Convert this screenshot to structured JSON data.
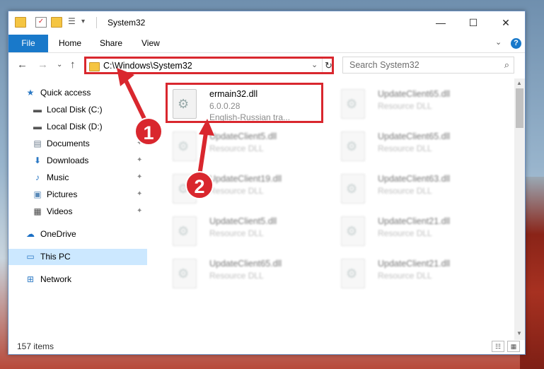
{
  "window": {
    "title": "System32",
    "controls": {
      "minimize": "—",
      "maximize": "☐",
      "close": "✕"
    }
  },
  "quick_access_toolbar": {
    "dropdown": "▾"
  },
  "ribbon": {
    "tabs": [
      {
        "label": "File",
        "active": true
      },
      {
        "label": "Home"
      },
      {
        "label": "Share"
      },
      {
        "label": "View"
      }
    ],
    "help": "?",
    "expand": "⌄"
  },
  "navigation": {
    "back": "←",
    "forward": "→",
    "recent": "⌄",
    "up": "↑",
    "address": "C:\\Windows\\System32",
    "address_dropdown": "⌄",
    "refresh": "↻",
    "search_placeholder": "Search System32",
    "search_icon": "⌕"
  },
  "sidebar": {
    "items": [
      {
        "label": "Quick access",
        "icon": "star-icon",
        "glyph": "★",
        "color": "#2a78c4"
      },
      {
        "label": "Local Disk (C:)",
        "icon": "drive-icon",
        "glyph": "▬",
        "color": "#555555",
        "pinned": true
      },
      {
        "label": "Local Disk (D:)",
        "icon": "drive-icon",
        "glyph": "▬",
        "color": "#555555",
        "pinned": true
      },
      {
        "label": "Documents",
        "icon": "documents-icon",
        "glyph": "▤",
        "color": "#6b7b8c",
        "pinned": true
      },
      {
        "label": "Downloads",
        "icon": "downloads-icon",
        "glyph": "⬇",
        "color": "#2a78c4",
        "pinned": true
      },
      {
        "label": "Music",
        "icon": "music-icon",
        "glyph": "♪",
        "color": "#2a78c4",
        "pinned": true
      },
      {
        "label": "Pictures",
        "icon": "pictures-icon",
        "glyph": "▣",
        "color": "#5a8ab8",
        "pinned": true
      },
      {
        "label": "Videos",
        "icon": "videos-icon",
        "glyph": "▦",
        "color": "#444444",
        "pinned": true
      },
      {
        "label": "OneDrive",
        "icon": "onedrive-icon",
        "glyph": "☁",
        "color": "#1a6fc4"
      },
      {
        "label": "This PC",
        "icon": "computer-icon",
        "glyph": "▭",
        "color": "#2a78c4",
        "selected": true
      },
      {
        "label": "Network",
        "icon": "network-icon",
        "glyph": "⊞",
        "color": "#2a78c4"
      }
    ],
    "pin_glyph": "📌"
  },
  "files": {
    "highlighted": {
      "name": "ermain32.dll",
      "version": "6.0.0.28",
      "description": "English-Russian tra..."
    },
    "others": [
      {
        "name": "UpdateClient65.dll",
        "type": "Resource DLL"
      },
      {
        "name": "UpdateClient5.dll",
        "type": "Resource DLL"
      },
      {
        "name": "UpdateClient65.dll",
        "type": "Resource DLL"
      },
      {
        "name": "UpdateClient19.dll",
        "type": "Resource DLL"
      },
      {
        "name": "UpdateClient63.dll",
        "type": "Resource DLL"
      },
      {
        "name": "UpdateClient5.dll",
        "type": "Resource DLL"
      },
      {
        "name": "UpdateClient21.dll",
        "type": "Resource DLL"
      },
      {
        "name": "UpdateClient65.dll",
        "type": "Resource DLL"
      },
      {
        "name": "UpdateClient21.dll",
        "type": "Resource DLL"
      }
    ]
  },
  "status": {
    "item_count": "157 items"
  },
  "callouts": [
    "1",
    "2"
  ],
  "colors": {
    "accent": "#1979ca",
    "highlight_red": "#d9272e",
    "selection": "#cce8ff"
  }
}
